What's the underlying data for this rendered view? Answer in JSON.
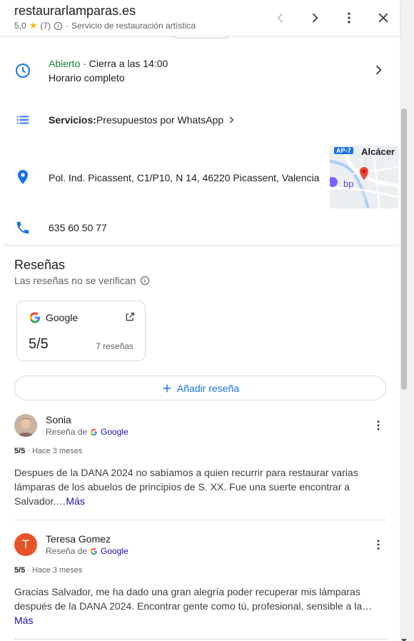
{
  "header": {
    "title": "restaurarlamparas.es",
    "rating": "5,0",
    "count": "(7)",
    "sep": "·",
    "category": "Servicio de restauración artística"
  },
  "hours": {
    "status": "Abierto",
    "closes": " · Cierra a las 14:00",
    "full": "Horario completo"
  },
  "services": {
    "label": "Servicios:",
    "value": " Presupuestos por WhatsApp"
  },
  "address": {
    "text": "Pol. Ind. Picassent, C1/P10, N 14, 46220 Picassent, Valencia",
    "map_road_label": "AP-7",
    "map_town_label": "Alcácer",
    "map_poi_label": "bp"
  },
  "phone": {
    "number": "635 60 50 77"
  },
  "reviews_section": {
    "title": "Reseñas",
    "note": "Las reseñas no se verifican",
    "card": {
      "source": "Google",
      "score": "5/5",
      "count": "7 reseñas"
    },
    "add_label": "Añadir reseña"
  },
  "reviews": [
    {
      "name": "Sonia",
      "source_prefix": "Reseña de",
      "source": "Google",
      "score": "5/5",
      "time": "· Hace 3 meses",
      "text": "Despues de la DANA 2024 no sabíamos a quien recurrir para restaurar varias lámparas de los abuelos de principios de S. XX. Fue una suerte encontrar a Salvador.…",
      "more": "Más"
    },
    {
      "name": "Teresa Gomez",
      "initial": "T",
      "source_prefix": "Reseña de",
      "source": "Google",
      "score": "5/5",
      "time": "· Hace 3 meses",
      "text": "Gracias Salvador, me ha dado una gran alegría poder recuperar mis lámparas después de la DANA 2024. Encontrar gente como tú, profesional, sensible a la…",
      "more": "Más"
    }
  ],
  "colors": {
    "accent_blue": "#1a73e8",
    "open_green": "#188038",
    "star_yellow": "#f4b400",
    "avatar_orange": "#e8542a"
  }
}
